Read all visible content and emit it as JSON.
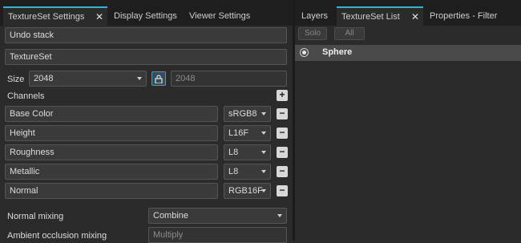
{
  "left_tabs": [
    {
      "label": "TextureSet Settings",
      "active": true
    },
    {
      "label": "Display Settings",
      "active": false
    },
    {
      "label": "Viewer Settings",
      "active": false
    }
  ],
  "right_tabs": [
    {
      "label": "Layers",
      "active": false
    },
    {
      "label": "TextureSet List",
      "active": true
    },
    {
      "label": "Properties - Filter",
      "active": false
    }
  ],
  "close_glyph": "✕",
  "undo_stack_label": "Undo stack",
  "textureset_name": "TextureSet",
  "size": {
    "label": "Size",
    "value": "2048",
    "linked_value": "2048",
    "lock_icon": "lock-icon"
  },
  "channels": {
    "title": "Channels",
    "add_symbol": "+",
    "remove_symbol": "−",
    "items": [
      {
        "name": "Base Color",
        "format": "sRGB8"
      },
      {
        "name": "Height",
        "format": "L16F"
      },
      {
        "name": "Roughness",
        "format": "L8"
      },
      {
        "name": "Metallic",
        "format": "L8"
      },
      {
        "name": "Normal",
        "format": "RGB16F"
      }
    ]
  },
  "normal_mixing": {
    "label": "Normal mixing",
    "value": "Combine"
  },
  "ao_mixing": {
    "label": "Ambient occlusion mixing",
    "value": "Multiply"
  },
  "textureset_list": {
    "solo_label": "Solo",
    "all_label": "All",
    "items": [
      {
        "name": "Sphere",
        "selected": true
      }
    ]
  },
  "colors": {
    "accent": "#1dbde0",
    "panel": "#2b2b2b",
    "tabbar": "#1e1e1e"
  }
}
